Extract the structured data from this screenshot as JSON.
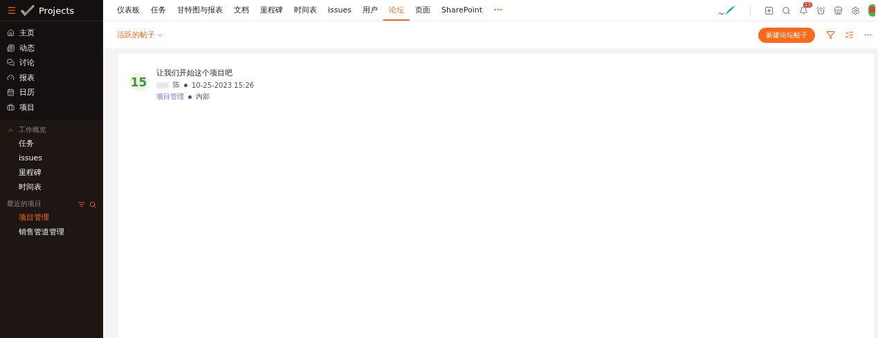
{
  "app": {
    "name": "Projects"
  },
  "sidebar": {
    "main_items": [
      {
        "label": "主页"
      },
      {
        "label": "动态"
      },
      {
        "label": "讨论"
      },
      {
        "label": "报表"
      },
      {
        "label": "日历"
      },
      {
        "label": "项目"
      }
    ],
    "work_overview": {
      "title": "工作概览",
      "expanded": true,
      "items": [
        {
          "label": "任务"
        },
        {
          "label": "issues"
        },
        {
          "label": "里程碑"
        },
        {
          "label": "时间表"
        }
      ]
    },
    "recent_projects": {
      "title": "最近的项目",
      "items": [
        {
          "label": "项目管理",
          "selected": true
        },
        {
          "label": "销售管道管理",
          "selected": false
        }
      ]
    }
  },
  "tabs": [
    {
      "label": "仪表板",
      "selected": false
    },
    {
      "label": "任务",
      "selected": false
    },
    {
      "label": "甘特图与报表",
      "selected": false
    },
    {
      "label": "文档",
      "selected": false
    },
    {
      "label": "里程碑",
      "selected": false
    },
    {
      "label": "时间表",
      "selected": false
    },
    {
      "label": "issues",
      "selected": false
    },
    {
      "label": "用户",
      "selected": false
    },
    {
      "label": "论坛",
      "selected": true
    },
    {
      "label": "页面",
      "selected": false
    },
    {
      "label": "SharePoint",
      "selected": false
    }
  ],
  "notifications": {
    "count": "13"
  },
  "toolbar": {
    "filter_label": "活跃的帖子",
    "new_button": "新建论坛帖子"
  },
  "posts": [
    {
      "avatar": "15",
      "title": "让我们开始这个项目吧",
      "author": "陈",
      "date": "10-25-2023 15:26",
      "project": "项目管理",
      "visibility": "内部"
    }
  ]
}
